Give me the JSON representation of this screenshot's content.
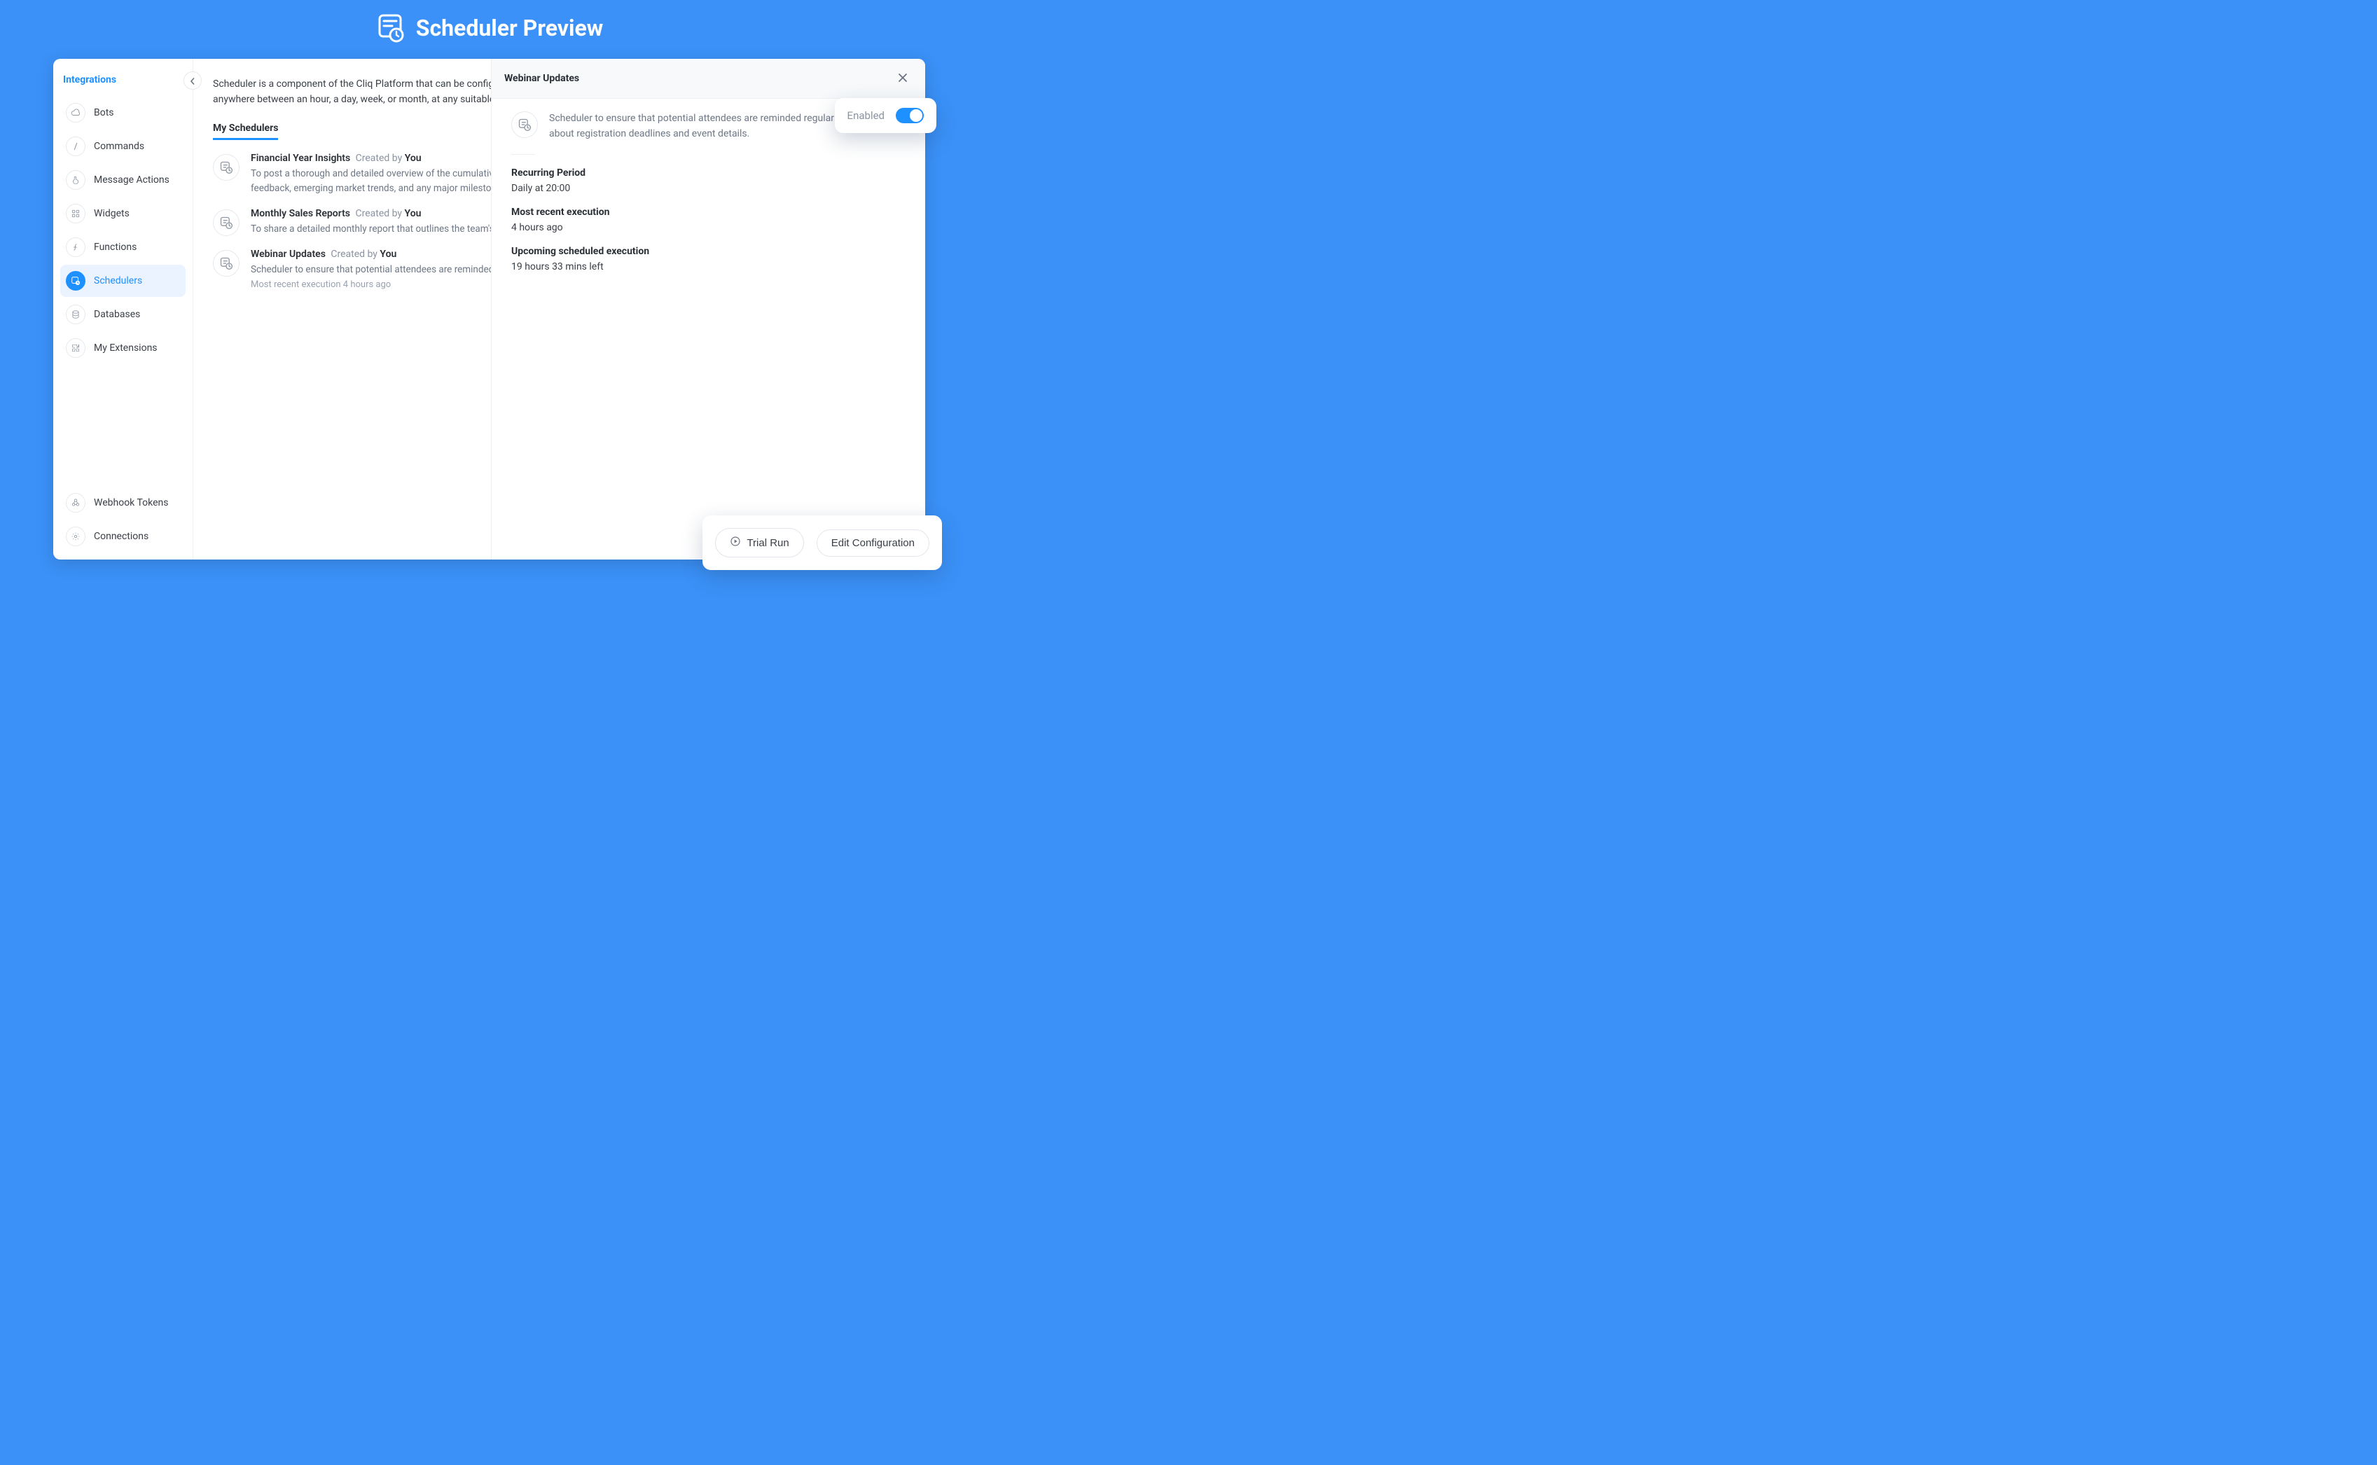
{
  "header": {
    "title": "Scheduler Preview"
  },
  "sidebar": {
    "title": "Integrations",
    "items": [
      {
        "label": "Bots"
      },
      {
        "label": "Commands"
      },
      {
        "label": "Message Actions"
      },
      {
        "label": "Widgets"
      },
      {
        "label": "Functions"
      },
      {
        "label": "Schedulers"
      },
      {
        "label": "Databases"
      },
      {
        "label": "My Extensions"
      }
    ],
    "bottom": [
      {
        "label": "Webhook Tokens"
      },
      {
        "label": "Connections"
      }
    ]
  },
  "main": {
    "intro": "Scheduler is a component of the Cliq Platform that can be configured to perform a task periodically. The time period may vary anywhere between an hour, a day, week, or month, at any suitable time slot.",
    "section_title": "My Schedulers",
    "created_by_prefix": "Created by",
    "you": "You",
    "schedulers": [
      {
        "name": "Financial Year Insights",
        "desc": "To post a thorough and detailed overview of the cumulative updates regarding premium services, incorporating key performance metrics, customer feedback, emerging market trends, and any major milestones or transformations."
      },
      {
        "name": "Monthly Sales Reports",
        "desc": "To share a detailed monthly report that outlines the team's performance."
      },
      {
        "name": "Webinar Updates",
        "desc": "Scheduler to ensure that potential attendees are reminded regularly about registration deadlines and event details.",
        "sub": "Most recent execution 4 hours ago"
      }
    ]
  },
  "detail": {
    "title": "Webinar Updates",
    "desc": "Scheduler to ensure that potential attendees are reminded regularly about registration deadlines and event details.",
    "recurring_label": "Recurring Period",
    "recurring_value": "Daily at 20:00",
    "recent_label": "Most recent execution",
    "recent_value": "4 hours ago",
    "upcoming_label": "Upcoming scheduled execution",
    "upcoming_value": "19 hours 33 mins left"
  },
  "enabled_card": {
    "label": "Enabled",
    "value": true
  },
  "actions": {
    "trial_run": "Trial Run",
    "edit": "Edit Configuration"
  }
}
